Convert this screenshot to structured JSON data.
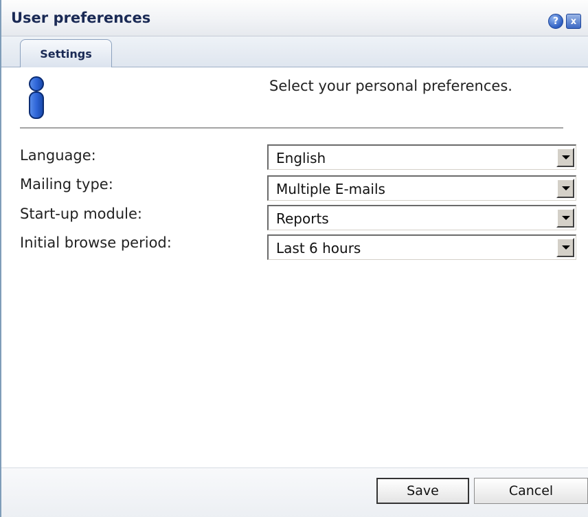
{
  "window": {
    "title": "User preferences",
    "help_label": "?",
    "close_label": "x"
  },
  "tabs": [
    {
      "label": "Settings",
      "active": true
    }
  ],
  "intro": {
    "text": "Select your personal preferences.",
    "icon": "user-icon"
  },
  "fields": [
    {
      "label": "Language:",
      "value": "English"
    },
    {
      "label": "Mailing type:",
      "value": "Multiple E-mails"
    },
    {
      "label": "Start-up module:",
      "value": "Reports"
    },
    {
      "label": "Initial browse period:",
      "value": "Last 6 hours"
    }
  ],
  "buttons": {
    "save": "Save",
    "cancel": "Cancel"
  },
  "colors": {
    "title_text": "#1a2a55",
    "accent_blue": "#2e5fc2",
    "separator": "#a3a3a3"
  }
}
